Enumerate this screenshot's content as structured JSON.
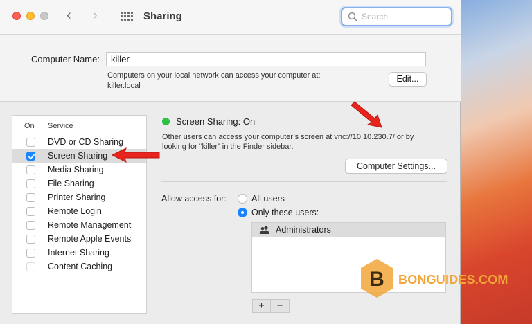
{
  "window": {
    "title": "Sharing",
    "back_glyph": "‹",
    "forward_glyph": "›"
  },
  "search": {
    "placeholder": "Search"
  },
  "computer_name": {
    "label": "Computer Name:",
    "value": "killer",
    "description_line1": "Computers on your local network can access your computer at:",
    "description_line2": "killer.local",
    "edit_button": "Edit..."
  },
  "services": {
    "header_on": "On",
    "header_service": "Service",
    "items": [
      {
        "label": "DVD or CD Sharing",
        "checked": false
      },
      {
        "label": "Screen Sharing",
        "checked": true
      },
      {
        "label": "Media Sharing",
        "checked": false
      },
      {
        "label": "File Sharing",
        "checked": false
      },
      {
        "label": "Printer Sharing",
        "checked": false
      },
      {
        "label": "Remote Login",
        "checked": false
      },
      {
        "label": "Remote Management",
        "checked": false
      },
      {
        "label": "Remote Apple Events",
        "checked": false
      },
      {
        "label": "Internet Sharing",
        "checked": false
      },
      {
        "label": "Content Caching",
        "checked": false
      }
    ],
    "selected_index": 1
  },
  "detail": {
    "status": "Screen Sharing: On",
    "status_color": "#2ec045",
    "description_line1": "Other users can access your computer’s screen at vnc://10.10.230.7/ or by",
    "description_line2": "looking for “killer” in the Finder sidebar.",
    "settings_button": "Computer Settings...",
    "allow_label": "Allow access for:",
    "option_all": "All users",
    "option_only": "Only these users:",
    "selected_option": "Only these users:",
    "users": [
      "Administrators"
    ],
    "add_glyph": "+",
    "remove_glyph": "−"
  },
  "watermark": {
    "logo_letter": "B",
    "text": "BONGUIDES.COM"
  },
  "colors": {
    "accent": "#1a84ff",
    "annotation_arrow": "#e8241c",
    "watermark": "#f2a63a"
  }
}
